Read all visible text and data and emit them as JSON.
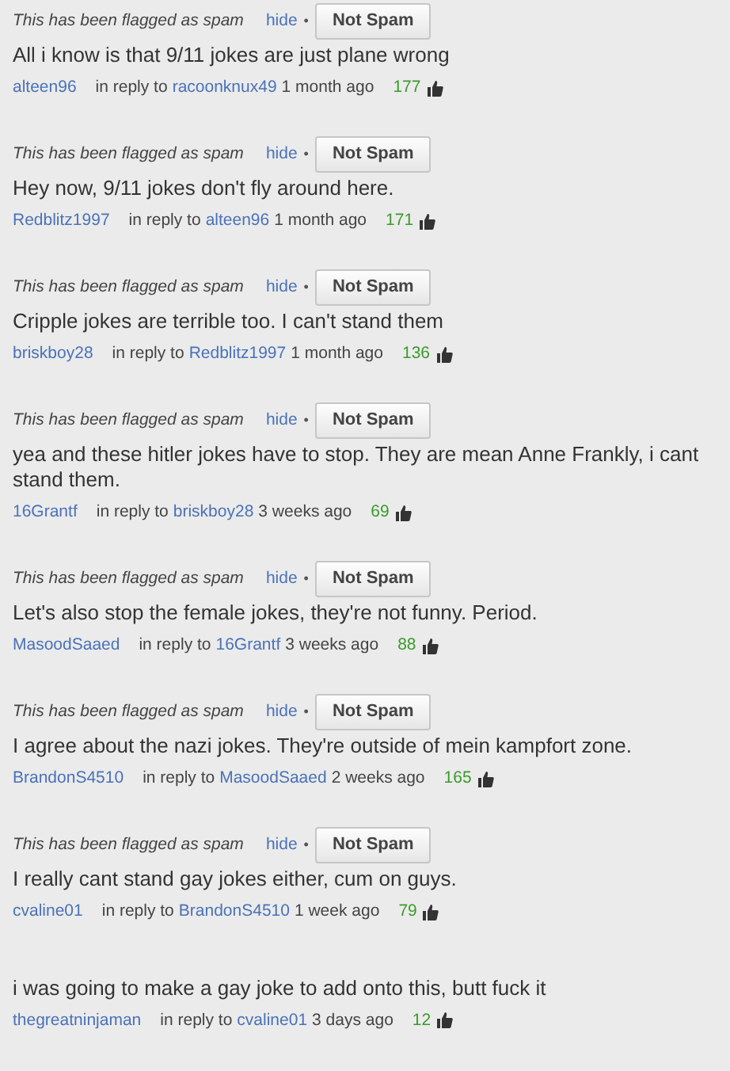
{
  "comments": [
    {
      "flagged": true,
      "flag_text": "This has been flagged as spam",
      "hide": "hide",
      "separator": "•",
      "button": "Not Spam",
      "text": "All i know is that 9/11 jokes are just plane wrong",
      "author": "alteen96",
      "reply_prefix": "in reply to",
      "reply_to": "racoonknux49",
      "time": "1 month ago",
      "votes": "177"
    },
    {
      "flagged": true,
      "flag_text": "This has been flagged as spam",
      "hide": "hide",
      "separator": "•",
      "button": "Not Spam",
      "text": "Hey now, 9/11 jokes don't fly around here.",
      "author": "Redblitz1997",
      "reply_prefix": "in reply to",
      "reply_to": "alteen96",
      "time": "1 month ago",
      "votes": "171"
    },
    {
      "flagged": true,
      "flag_text": "This has been flagged as spam",
      "hide": "hide",
      "separator": "•",
      "button": "Not Spam",
      "text": "Cripple jokes are terrible too. I can't stand them",
      "author": "briskboy28",
      "reply_prefix": "in reply to",
      "reply_to": "Redblitz1997",
      "time": "1 month ago",
      "votes": "136"
    },
    {
      "flagged": true,
      "flag_text": "This has been flagged as spam",
      "hide": "hide",
      "separator": "•",
      "button": "Not Spam",
      "text": "yea and these hitler jokes have to stop. They are mean Anne Frankly, i cant stand them.",
      "author": "16Grantf",
      "reply_prefix": "in reply to",
      "reply_to": "briskboy28",
      "time": "3 weeks ago",
      "votes": "69"
    },
    {
      "flagged": true,
      "flag_text": "This has been flagged as spam",
      "hide": "hide",
      "separator": "•",
      "button": "Not Spam",
      "text": "Let's also stop the female jokes, they're not funny. Period.",
      "author": "MasoodSaaed",
      "reply_prefix": "in reply to",
      "reply_to": "16Grantf",
      "time": "3 weeks ago",
      "votes": "88"
    },
    {
      "flagged": true,
      "flag_text": "This has been flagged as spam",
      "hide": "hide",
      "separator": "•",
      "button": "Not Spam",
      "text": "I agree about the nazi jokes. They're outside of mein kampfort zone.",
      "author": "BrandonS4510",
      "reply_prefix": "in reply to",
      "reply_to": "MasoodSaaed",
      "time": "2 weeks ago",
      "votes": "165"
    },
    {
      "flagged": true,
      "flag_text": "This has been flagged as spam",
      "hide": "hide",
      "separator": "•",
      "button": "Not Spam",
      "text": "I really cant stand gay jokes either, cum on guys.",
      "author": "cvaline01",
      "reply_prefix": "in reply to",
      "reply_to": "BrandonS4510",
      "time": "1 week ago",
      "votes": "79"
    },
    {
      "flagged": false,
      "text": "i was going to make a gay joke to add onto this, butt fuck it",
      "author": "thegreatninjaman",
      "reply_prefix": "in reply to",
      "reply_to": "cvaline01",
      "time": "3 days ago",
      "votes": "12"
    }
  ]
}
